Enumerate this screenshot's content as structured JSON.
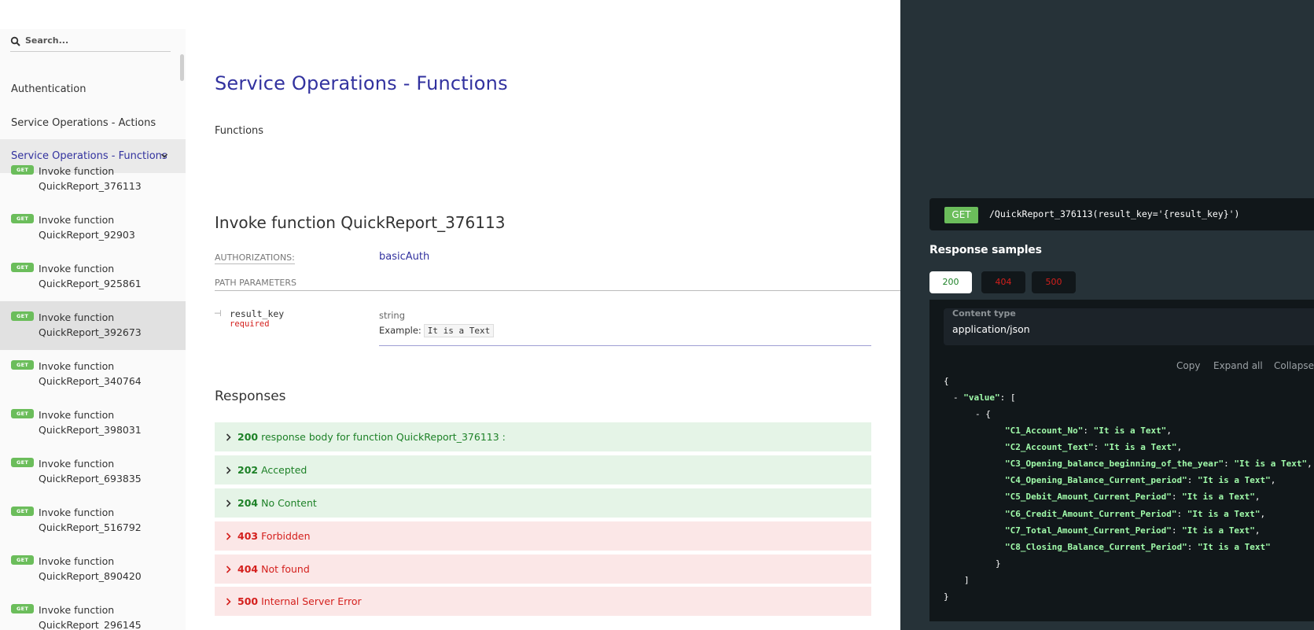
{
  "sidebar": {
    "search_placeholder": "Search...",
    "sections": [
      {
        "label": "Authentication"
      },
      {
        "label": "Service Operations - Actions"
      },
      {
        "label": "Service Operations - Functions"
      }
    ],
    "operations": [
      {
        "method": "GET",
        "line1": "Invoke function",
        "line2": "QuickReport_376113"
      },
      {
        "method": "GET",
        "line1": "Invoke function",
        "line2": "QuickReport_92903"
      },
      {
        "method": "GET",
        "line1": "Invoke function",
        "line2": "QuickReport_925861"
      },
      {
        "method": "GET",
        "line1": "Invoke function",
        "line2": "QuickReport_392673"
      },
      {
        "method": "GET",
        "line1": "Invoke function",
        "line2": "QuickReport_340764"
      },
      {
        "method": "GET",
        "line1": "Invoke function",
        "line2": "QuickReport_398031"
      },
      {
        "method": "GET",
        "line1": "Invoke function",
        "line2": "QuickReport_693835"
      },
      {
        "method": "GET",
        "line1": "Invoke function",
        "line2": "QuickReport_516792"
      },
      {
        "method": "GET",
        "line1": "Invoke function",
        "line2": "QuickReport_890420"
      },
      {
        "method": "GET",
        "line1": "Invoke function",
        "line2": "QuickReport_296145"
      }
    ]
  },
  "main": {
    "title": "Service Operations - Functions",
    "description": "Functions",
    "operation_title": "Invoke function QuickReport_376113",
    "authorizations_label": "AUTHORIZATIONS:",
    "authorizations_value": "basicAuth",
    "path_params_label": "PATH PARAMETERS",
    "param": {
      "name": "result_key",
      "required": "required",
      "type": "string",
      "example_label": "Example:",
      "example_value": "It is a Text"
    },
    "responses_title": "Responses",
    "responses": [
      {
        "code": "200",
        "text": "response body for function QuickReport_376113 :"
      },
      {
        "code": "202",
        "text": "Accepted"
      },
      {
        "code": "204",
        "text": "No Content"
      },
      {
        "code": "403",
        "text": "Forbidden"
      },
      {
        "code": "404",
        "text": "Not found"
      },
      {
        "code": "500",
        "text": "Internal Server Error"
      }
    ]
  },
  "right": {
    "method": "GET",
    "endpoint": "/QuickReport_376113(result_key='{result_key}')",
    "samples_title": "Response samples",
    "tabs": [
      "200",
      "404",
      "500"
    ],
    "content_type_label": "Content type",
    "content_type_value": "application/json",
    "tools": [
      "Copy",
      "Expand all",
      "Collapse"
    ],
    "code": {
      "open_brace": "{",
      "value_key": "\"value\"",
      "fields": [
        {
          "key": "\"C1_Account_No\"",
          "value": "\"It is a Text\""
        },
        {
          "key": "\"C2_Account_Text\"",
          "value": "\"It is a Text\""
        },
        {
          "key": "\"C3_Opening_balance_beginning_of_the_year\"",
          "value": "\"It is a Text\""
        },
        {
          "key": "\"C4_Opening_Balance_Current_period\"",
          "value": "\"It is a Text\""
        },
        {
          "key": "\"C5_Debit_Amount_Current_Period\"",
          "value": "\"It is a Text\""
        },
        {
          "key": "\"C6_Credit_Amount_Current_Period\"",
          "value": "\"It is a Text\""
        },
        {
          "key": "\"C7_Total_Amount_Current_Period\"",
          "value": "\"It is a Text\""
        },
        {
          "key": "\"C8_Closing_Balance_Current_Period\"",
          "value": "\"It is a Text\""
        }
      ]
    }
  },
  "colors": {
    "accent": "#32329f",
    "get_badge": "#6bbd5b",
    "success": "#1d8127",
    "error": "#d41f1c",
    "right_panel": "#263238"
  }
}
